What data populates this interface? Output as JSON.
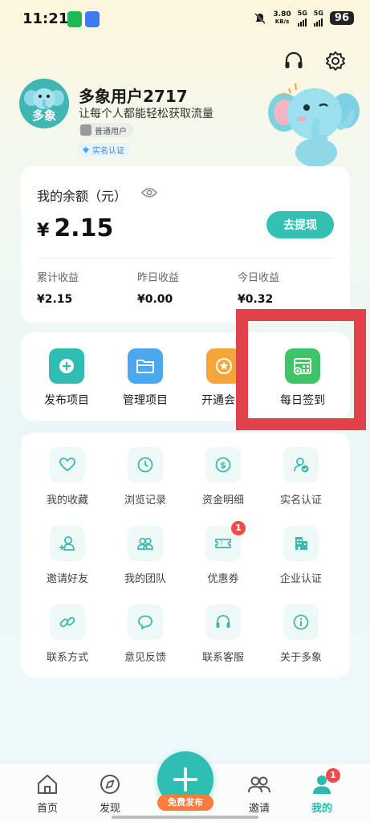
{
  "status_bar": {
    "time": "11:21",
    "net_speed": "3.80",
    "net_unit": "KB/s",
    "sim1": "5G",
    "sim2": "5G",
    "battery": "96"
  },
  "header": {
    "icons": [
      "headset-icon",
      "settings-gear-icon"
    ]
  },
  "profile": {
    "avatar_text": "多象",
    "username": "多象用户2717",
    "slogan": "让每个人都能轻松获取流量",
    "user_type": "普通用户",
    "verify_label": "实名认证"
  },
  "balance": {
    "title": "我的余额（元）",
    "currency": "¥",
    "amount": "2.15",
    "withdraw_label": "去提现",
    "stats": [
      {
        "label": "累计收益",
        "value": "¥2.15"
      },
      {
        "label": "昨日收益",
        "value": "¥0.00"
      },
      {
        "label": "今日收益",
        "value": "¥0.32"
      }
    ]
  },
  "quick_actions": [
    {
      "label": "发布项目",
      "icon": "plus-circle-icon",
      "color": "#2fbdb3"
    },
    {
      "label": "管理项目",
      "icon": "folder-icon",
      "color": "#4aa8ef"
    },
    {
      "label": "开通会员",
      "icon": "vip-star-icon",
      "color": "#f6a53b"
    },
    {
      "label": "每日签到",
      "icon": "calendar-checkin-icon",
      "color": "#3fc567"
    }
  ],
  "menu": [
    {
      "label": "我的收藏",
      "icon": "heart-icon"
    },
    {
      "label": "浏览记录",
      "icon": "clock-icon"
    },
    {
      "label": "资金明细",
      "icon": "dollar-icon"
    },
    {
      "label": "实名认证",
      "icon": "user-verified-icon"
    },
    {
      "label": "邀请好友",
      "icon": "add-user-icon"
    },
    {
      "label": "我的团队",
      "icon": "team-icon"
    },
    {
      "label": "优惠券",
      "icon": "coupon-icon",
      "badge": "1"
    },
    {
      "label": "企业认证",
      "icon": "building-icon"
    },
    {
      "label": "联系方式",
      "icon": "link-icon"
    },
    {
      "label": "意见反馈",
      "icon": "chat-icon"
    },
    {
      "label": "联系客服",
      "icon": "headset-icon"
    },
    {
      "label": "关于多象",
      "icon": "info-icon"
    }
  ],
  "tabbar": {
    "tabs": [
      {
        "label": "首页",
        "icon": "home-icon"
      },
      {
        "label": "发现",
        "icon": "compass-icon"
      },
      {
        "label": "邀请",
        "icon": "invite-users-icon"
      },
      {
        "label": "我的",
        "icon": "profile-icon",
        "badge": "1"
      }
    ],
    "publish_label": "免费发布",
    "accent": "#2fbdb3"
  }
}
